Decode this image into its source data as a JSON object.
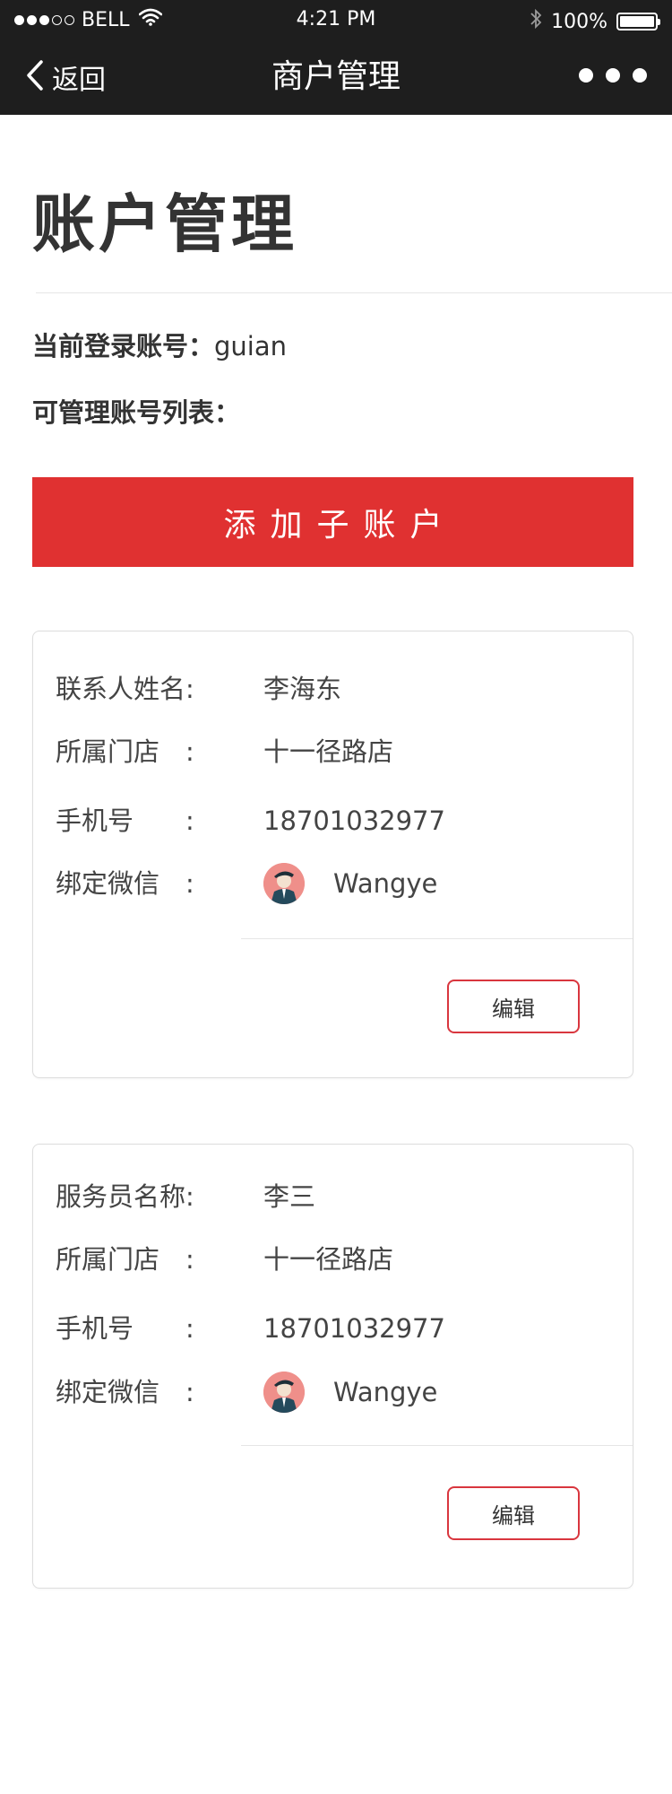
{
  "status_bar": {
    "carrier": "BELL",
    "time": "4:21 PM",
    "battery": "100%"
  },
  "nav": {
    "back_label": "返回",
    "title": "商户管理"
  },
  "page": {
    "title": "账户管理",
    "current_account_label": "当前登录账号：",
    "current_account_value": "guian",
    "manageable_list_label": "可管理账号列表："
  },
  "add_button_label": "添加子账户",
  "accounts": [
    {
      "name_label": "联系人姓名:",
      "name_value": "李海东",
      "store_label": "所属门店　:",
      "store_value": "十一径路店",
      "phone_label": "手机号　　:",
      "phone_value": "18701032977",
      "wechat_label": "绑定微信　:",
      "wechat_value": "Wangye",
      "edit_label": "编辑"
    },
    {
      "name_label": "服务员名称:",
      "name_value": "李三",
      "store_label": "所属门店　:",
      "store_value": "十一径路店",
      "phone_label": "手机号　　:",
      "phone_value": "18701032977",
      "wechat_label": "绑定微信　:",
      "wechat_value": "Wangye",
      "edit_label": "编辑"
    }
  ],
  "colors": {
    "topbar_bg": "#1e1e1e",
    "accent_red": "#e03131",
    "text": "#333333"
  }
}
